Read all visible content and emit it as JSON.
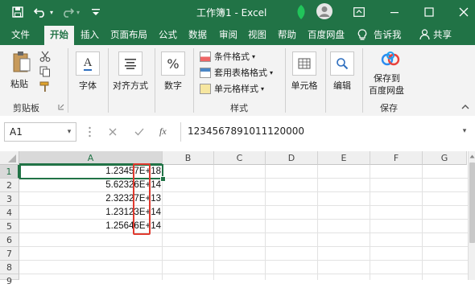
{
  "titlebar": {
    "title": "工作簿1 - Excel",
    "undo_icon": "undo-icon",
    "redo_icon": "redo-icon",
    "save_icon": "save-icon"
  },
  "tabs": [
    "文件",
    "开始",
    "插入",
    "页面布局",
    "公式",
    "数据",
    "审阅",
    "视图",
    "帮助",
    "百度网盘"
  ],
  "active_tab": "开始",
  "tell_me": "告诉我",
  "share": "共享",
  "ribbon": {
    "clipboard": {
      "paste": "粘贴",
      "group": "剪贴板"
    },
    "font": "字体",
    "alignment": "对齐方式",
    "number": "数字",
    "styles": {
      "conditional": "条件格式",
      "table": "套用表格格式",
      "cell_styles": "单元格样式",
      "group": "样式"
    },
    "cells": "单元格",
    "editing": "编辑",
    "save_baidu": {
      "line1": "保存到",
      "line2": "百度网盘",
      "group": "保存"
    }
  },
  "formula": {
    "name_box": "A1",
    "fx": "fx",
    "content": "1234567891011120000"
  },
  "columns": [
    "A",
    "B",
    "C",
    "D",
    "E",
    "F",
    "G"
  ],
  "rows": [
    "1",
    "2",
    "3",
    "4",
    "5",
    "6",
    "7",
    "8",
    "9"
  ],
  "cells_a": [
    {
      "pre": "1.23457",
      "suffix": "E+18"
    },
    {
      "pre": "5.62326",
      "suffix": "E+14"
    },
    {
      "pre": "2.32327",
      "suffix": "E+13"
    },
    {
      "pre": "1.23123",
      "suffix": "E+14"
    },
    {
      "pre": "1.25646",
      "suffix": "E+14"
    }
  ],
  "colors": {
    "excel_green": "#217346",
    "highlight_red": "#e03a2f"
  }
}
